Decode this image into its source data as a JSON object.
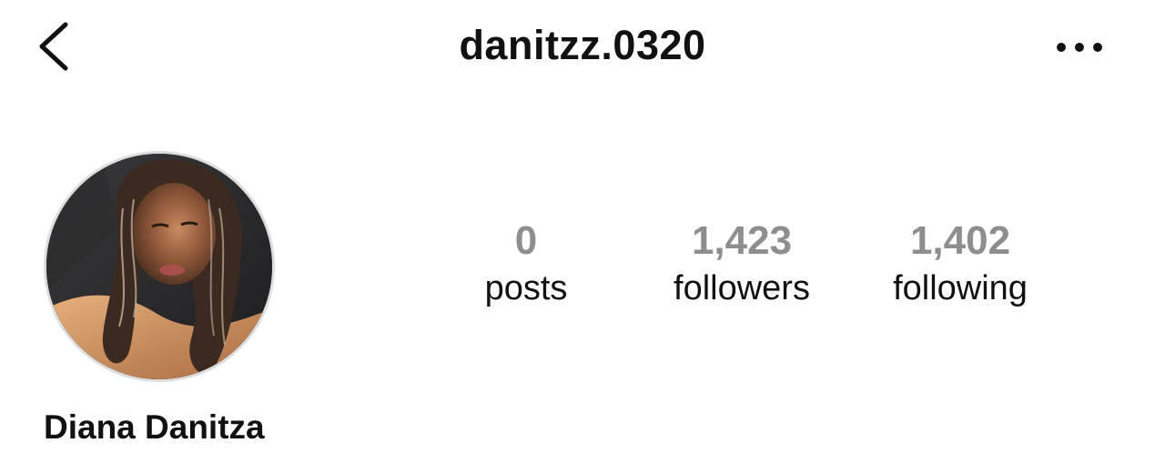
{
  "header": {
    "username": "danitzz.0320",
    "back_icon": "chevron-left-icon",
    "more_icon": "more-horizontal-icon"
  },
  "profile": {
    "display_name": "Diana Danitza",
    "avatar_icon": "profile-photo"
  },
  "stats": [
    {
      "value": "0",
      "label": "posts"
    },
    {
      "value": "1,423",
      "label": "followers"
    },
    {
      "value": "1,402",
      "label": "following"
    }
  ],
  "colors": {
    "text": "#111111",
    "muted": "#8e8e8e",
    "background": "#ffffff",
    "avatar_ring": "#dddddd"
  }
}
